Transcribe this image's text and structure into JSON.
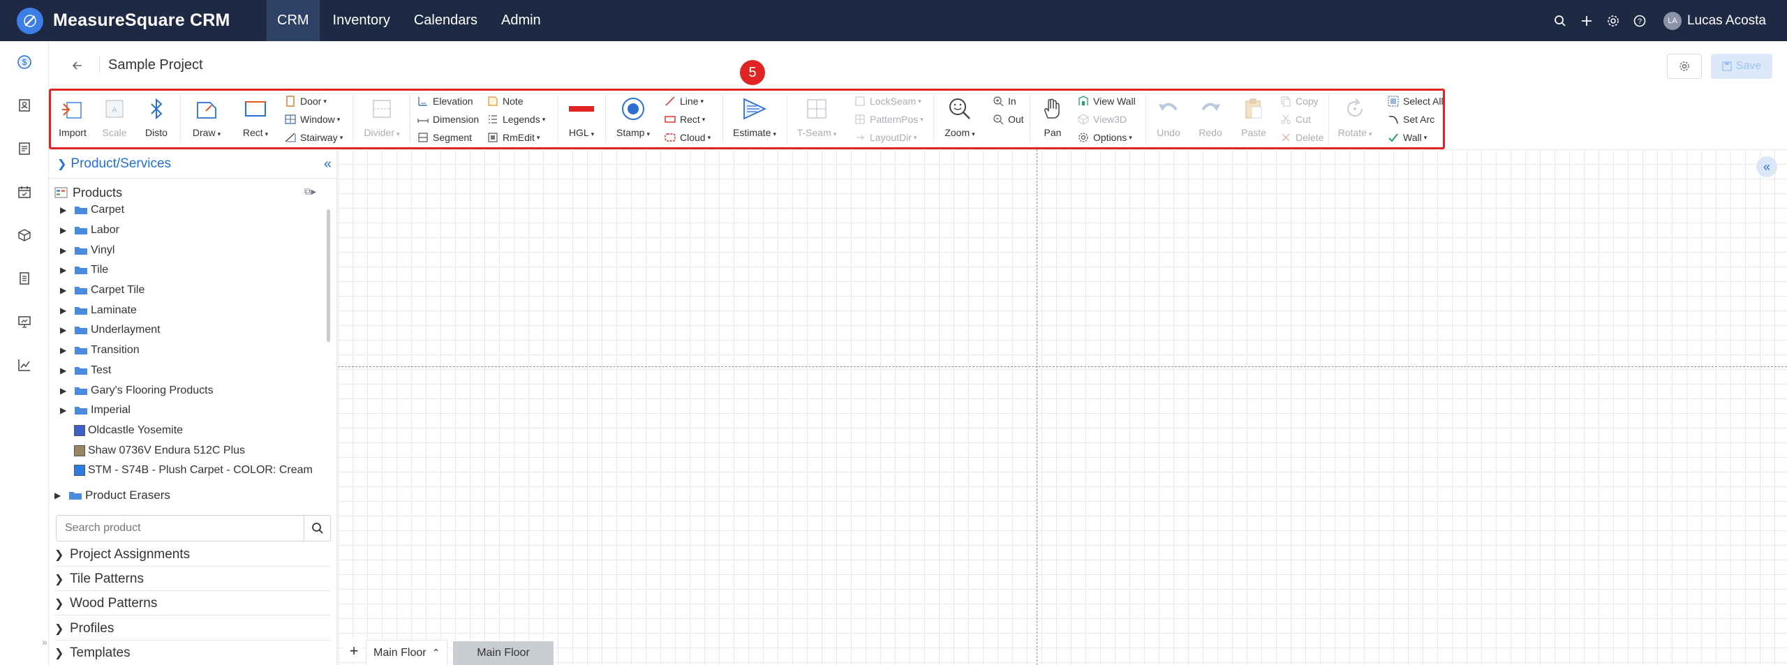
{
  "app": {
    "brand": "MeasureSquare CRM",
    "nav": [
      "CRM",
      "Inventory",
      "Calendars",
      "Admin"
    ],
    "active_nav": "CRM",
    "user": {
      "initials": "LA",
      "name": "Lucas Acosta"
    }
  },
  "page": {
    "title": "Sample Project",
    "save_label": "Save"
  },
  "annotation": {
    "badge": "5"
  },
  "toolbar": {
    "import": "Import",
    "scale": "Scale",
    "disto": "Disto",
    "draw": "Draw",
    "rect": "Rect",
    "door": "Door",
    "window": "Window",
    "stairway": "Stairway",
    "divider": "Divider",
    "elevation": "Elevation",
    "dimension": "Dimension",
    "segment": "Segment",
    "note": "Note",
    "legends": "Legends",
    "rmedit": "RmEdit",
    "hgl": "HGL",
    "stamp": "Stamp",
    "line": "Line",
    "rect_small": "Rect",
    "cloud": "Cloud",
    "estimate": "Estimate",
    "tseam": "T-Seam",
    "lockseam": "LockSeam",
    "patternpos": "PatternPos",
    "layoutdir": "LayoutDir",
    "zoom": "Zoom",
    "in": "In",
    "out": "Out",
    "pan": "Pan",
    "view_wall": "View Wall",
    "view3d": "View3D",
    "options": "Options",
    "undo": "Undo",
    "redo": "Redo",
    "paste": "Paste",
    "copy": "Copy",
    "cut": "Cut",
    "delete": "Delete",
    "rotate": "Rotate",
    "select_all": "Select All",
    "set_arc": "Set Arc",
    "wall": "Wall"
  },
  "panel": {
    "title": "Product/Services",
    "root": "Products",
    "categories": [
      "Carpet",
      "Labor",
      "Vinyl",
      "Tile",
      "Carpet Tile",
      "Laminate",
      "Underlayment",
      "Transition",
      "Test",
      "Gary's Flooring Products",
      "Imperial"
    ],
    "products": [
      {
        "name": "Oldcastle Yosemite",
        "color": "#3f5fc8"
      },
      {
        "name": "Shaw 0736V Endura 512C Plus",
        "color": "#9a8660"
      },
      {
        "name": "STM - S74B - Plush Carpet - COLOR: Cream",
        "color": "#2b7be0"
      }
    ],
    "erasers": "Product Erasers",
    "search_placeholder": "Search product",
    "sections": [
      "Project Assignments",
      "Tile Patterns",
      "Wood Patterns",
      "Profiles",
      "Templates"
    ]
  },
  "floors": {
    "add": "+",
    "current": "Main Floor",
    "tabs": [
      "Main Floor"
    ]
  },
  "colors": {
    "nav_bg": "#1e2a44",
    "accent": "#1f6fd6",
    "highlight": "#e02424"
  }
}
